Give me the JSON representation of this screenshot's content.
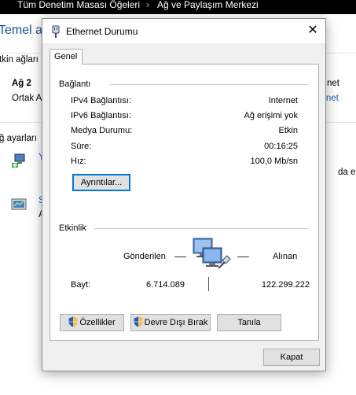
{
  "background": {
    "breadcrumb": [
      "Tüm Denetim Masası Öğeleri",
      "Ağ ve Paylaşım Merkezi"
    ],
    "breadcrumb_sep": "›",
    "heading": "Temel ağ",
    "active_networks_label": "tkin ağları",
    "network_name": "Ağ 2",
    "network_type": "Ortak A",
    "access_label_cut": "net",
    "connection_link_cut": "rnet",
    "settings_label": "ğ ayarları",
    "item1_link_cut": "Y",
    "item1_desc_cut": "da e",
    "item2_link_cut": "S",
    "item2_desc_cut": "A"
  },
  "dialog": {
    "title": "Ethernet Durumu",
    "close_glyph": "✕",
    "tab_label": "Genel",
    "connection": {
      "section_label": "Bağlantı",
      "rows": [
        {
          "label": "IPv4 Bağlantısı:",
          "value": "Internet"
        },
        {
          "label": "IPv6 Bağlantısı:",
          "value": "Ağ erişimi yok"
        },
        {
          "label": "Medya Durumu:",
          "value": "Etkin"
        },
        {
          "label": "Süre:",
          "value": "00:16:25"
        },
        {
          "label": "Hız:",
          "value": "100,0 Mb/sn"
        }
      ],
      "details_button": "Ayrıntılar..."
    },
    "activity": {
      "section_label": "Etkinlik",
      "sent_label": "Gönderilen",
      "received_label": "Alınan",
      "bytes_label": "Bayt:",
      "bytes_sent": "6.714.089",
      "bytes_received": "122.299.222"
    },
    "buttons": {
      "properties": "Özellikler",
      "disable": "Devre Dışı Bırak",
      "diagnose": "Tanıla",
      "close": "Kapat"
    },
    "icons": {
      "title": "ethernet-plug-icon",
      "shield": "uac-shield-icon",
      "activity": "network-computers-icon"
    }
  }
}
